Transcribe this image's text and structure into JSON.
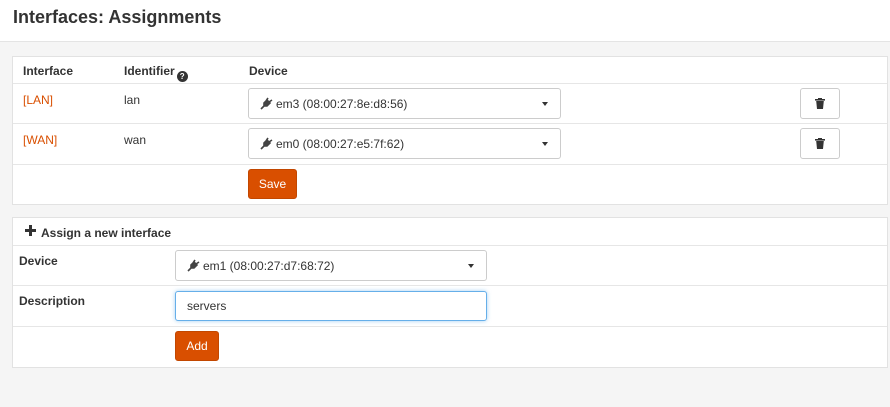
{
  "page": {
    "title": "Interfaces: Assignments"
  },
  "assignments": {
    "headers": {
      "interface": "Interface",
      "identifier": "Identifier",
      "device": "Device"
    },
    "help_icon": "question-circle-icon",
    "rows": [
      {
        "interface": "[LAN]",
        "identifier": "lan",
        "device": "em3 (08:00:27:8e:d8:56)"
      },
      {
        "interface": "[WAN]",
        "identifier": "wan",
        "device": "em0 (08:00:27:e5:7f:62)"
      }
    ],
    "delete_icon": "trash-icon",
    "save_label": "Save"
  },
  "new_interface": {
    "title": "Assign a new interface",
    "title_icon": "plus-icon",
    "device_label": "Device",
    "device_value": "em1 (08:00:27:d7:68:72)",
    "description_label": "Description",
    "description_value": "servers",
    "add_label": "Add"
  },
  "colors": {
    "accent": "#d94f00",
    "link": "#d94f00"
  }
}
